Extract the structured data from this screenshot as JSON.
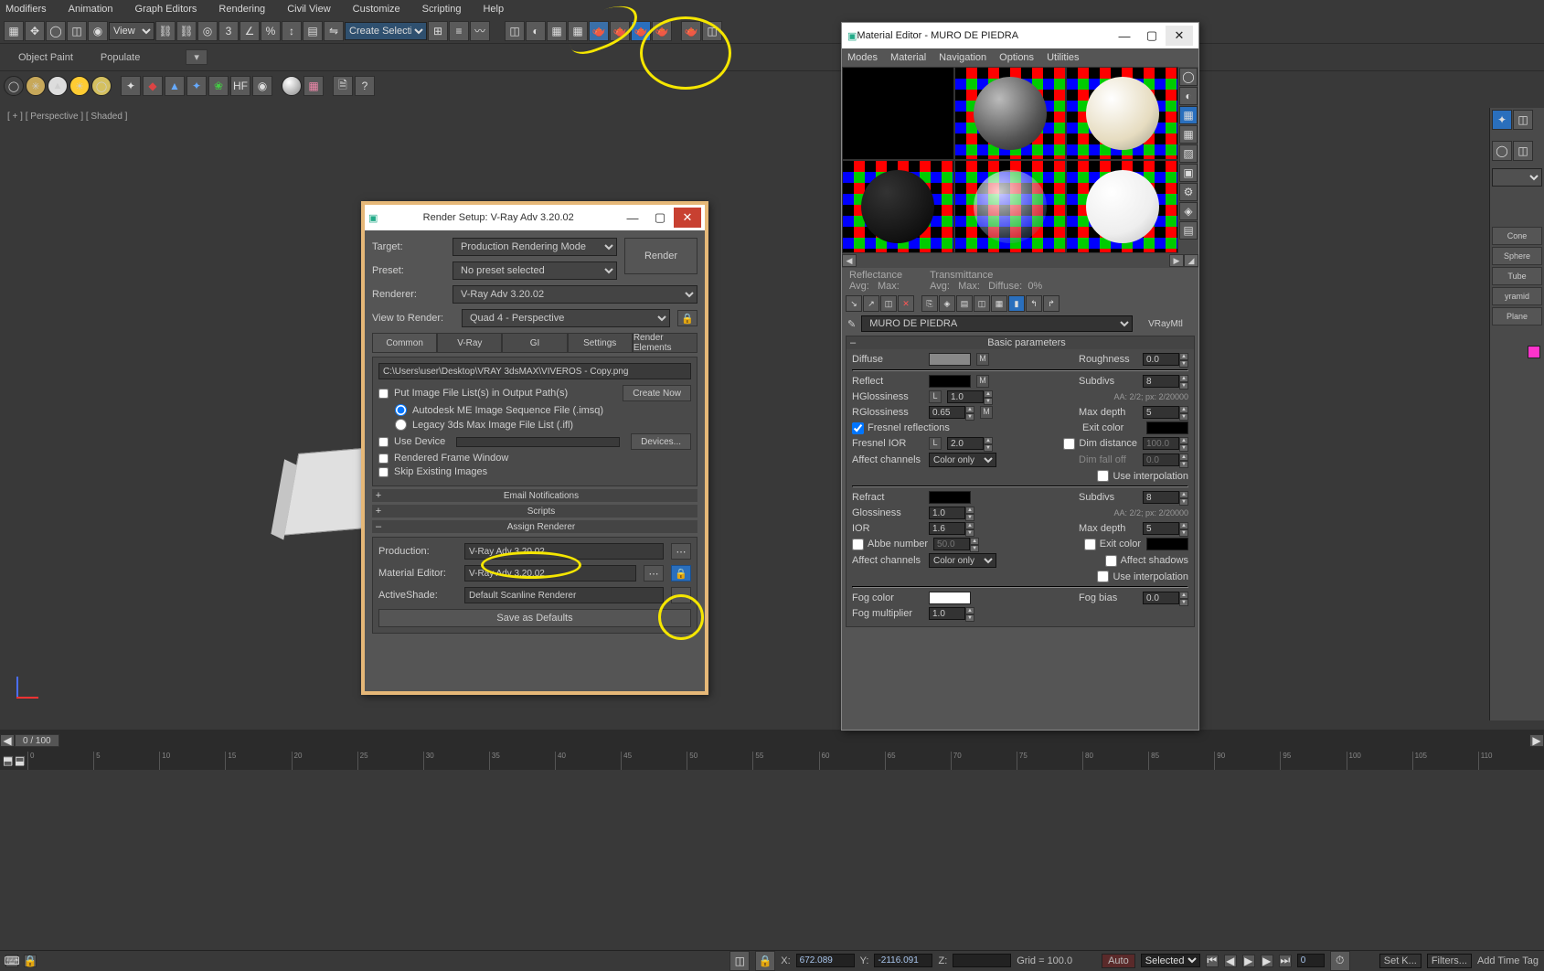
{
  "menu": [
    "Modifiers",
    "Animation",
    "Graph Editors",
    "Rendering",
    "Civil View",
    "Customize",
    "Scripting",
    "Help"
  ],
  "toolbar": {
    "view_label": "View",
    "create_sel": "Create Selection S"
  },
  "ribbon": {
    "object_paint": "Object Paint",
    "populate": "Populate"
  },
  "viewport": {
    "label": "[ + ] [ Perspective ] [ Shaded ]"
  },
  "timeline": {
    "badge": "0 / 100",
    "ticks": [
      "0",
      "5",
      "10",
      "15",
      "20",
      "25",
      "30",
      "35",
      "40",
      "45",
      "50",
      "55",
      "60",
      "65",
      "70",
      "75",
      "80",
      "85",
      "90",
      "95",
      "100",
      "105",
      "110"
    ]
  },
  "status": {
    "x_label": "X:",
    "x": "672.089",
    "y_label": "Y:",
    "y": "-2116.091",
    "z_label": "Z:",
    "z": "",
    "grid": "Grid = 100.0",
    "auto": "Auto",
    "selected": "Selected",
    "setk": "Set K...",
    "filters": "Filters...",
    "addtag": "Add Time Tag"
  },
  "render": {
    "title": "Render Setup: V-Ray Adv 3.20.02",
    "target_label": "Target:",
    "target": "Production Rendering Mode",
    "preset_label": "Preset:",
    "preset": "No preset selected",
    "renderer_label": "Renderer:",
    "renderer": "V-Ray Adv 3.20.02",
    "view_label": "View to Render:",
    "view": "Quad 4 - Perspective",
    "render_btn": "Render",
    "tabs": [
      "Common",
      "V-Ray",
      "GI",
      "Settings",
      "Render Elements"
    ],
    "output_path": "C:\\Users\\user\\Desktop\\VRAY 3dsMAX\\VIVEROS - Copy.png",
    "put_files": "Put Image File List(s) in Output Path(s)",
    "create_now": "Create Now",
    "imsq": "Autodesk ME Image Sequence File (.imsq)",
    "ifl": "Legacy 3ds Max Image File List (.ifl)",
    "use_device": "Use Device",
    "devices": "Devices...",
    "rfw": "Rendered Frame Window",
    "skip": "Skip Existing Images",
    "email": "Email Notifications",
    "scripts": "Scripts",
    "assign": "Assign Renderer",
    "production_lbl": "Production:",
    "production": "V-Ray Adv 3.20.02",
    "mateditor_lbl": "Material Editor:",
    "mateditor": "V-Ray Adv 3.20.02",
    "activeshade_lbl": "ActiveShade:",
    "activeshade": "Default Scanline Renderer",
    "save_defaults": "Save as Defaults"
  },
  "material": {
    "title": "Material Editor - MURO DE PIEDRA",
    "menu": [
      "Modes",
      "Material",
      "Navigation",
      "Options",
      "Utilities"
    ],
    "reflectance": "Reflectance",
    "transmittance": "Transmittance",
    "avg": "Avg:",
    "max": "Max:",
    "diffuse_pct": "Diffuse:",
    "pct": "0%",
    "name": "MURO DE PIEDRA",
    "type": "VRayMtl",
    "basic_params": "Basic parameters",
    "diffuse": "Diffuse",
    "roughness": "Roughness",
    "rough_v": "0.0",
    "reflect": "Reflect",
    "subdivs": "Subdivs",
    "subdivs_v": "8",
    "hgloss": "HGlossiness",
    "hgloss_v": "1.0",
    "aa": "AA: 2/2; px: 2/20000",
    "rgloss": "RGlossiness",
    "rgloss_v": "0.65",
    "maxdepth": "Max depth",
    "maxdepth_v": "5",
    "fresnel": "Fresnel reflections",
    "exit_color": "Exit color",
    "fresnel_ior": "Fresnel IOR",
    "fresnel_ior_v": "2.0",
    "dim_dist": "Dim distance",
    "dim_dist_v": "100.0",
    "affect": "Affect channels",
    "color_only": "Color only",
    "dim_fall": "Dim fall off",
    "dim_fall_v": "0.0",
    "use_interp": "Use interpolation",
    "refract": "Refract",
    "refr_subdivs_v": "8",
    "glossiness": "Glossiness",
    "gloss_v": "1.0",
    "ior": "IOR",
    "ior_v": "1.6",
    "refr_maxdepth_v": "5",
    "abbe": "Abbe number",
    "abbe_v": "50.0",
    "affect_shadows": "Affect shadows",
    "fog_color": "Fog color",
    "fog_bias": "Fog bias",
    "fog_bias_v": "0.0",
    "fog_mult": "Fog multiplier",
    "fog_mult_v": "1.0"
  },
  "cmdpanel": {
    "items": [
      "Cone",
      "Sphere",
      "Tube",
      "yramid",
      "Plane"
    ]
  }
}
